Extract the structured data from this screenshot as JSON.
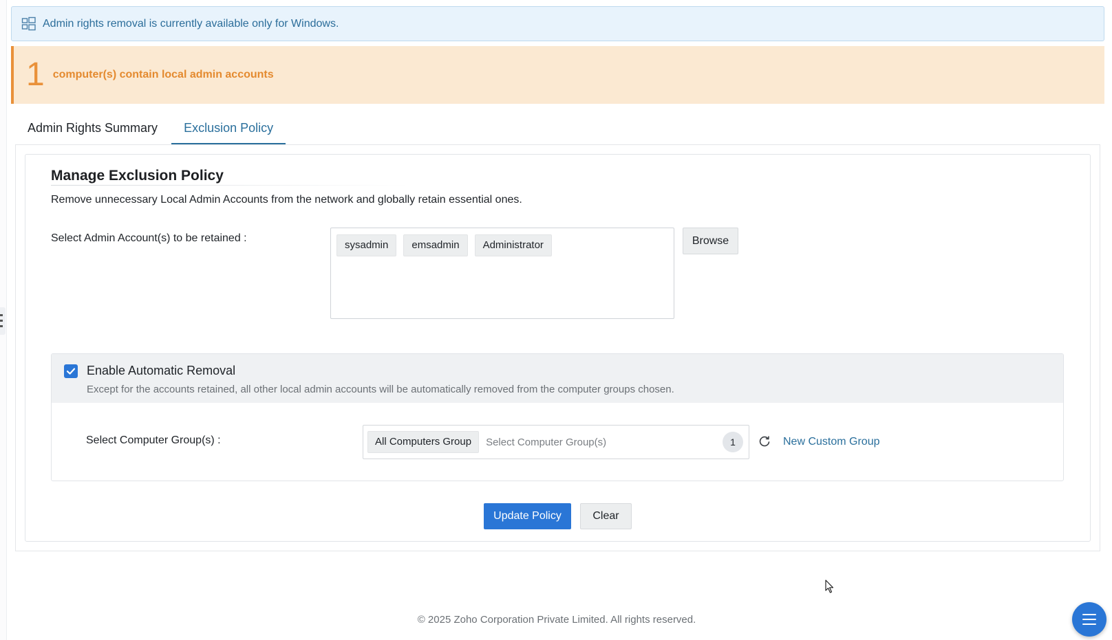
{
  "info_banner": {
    "text": "Admin rights removal is currently available only for Windows.",
    "icon": "windows-grid-icon"
  },
  "warning_banner": {
    "count": "1",
    "text": "computer(s) contain local admin accounts"
  },
  "tabs": [
    {
      "label": "Admin Rights Summary",
      "active": false
    },
    {
      "label": "Exclusion Policy",
      "active": true
    }
  ],
  "policy": {
    "title": "Manage Exclusion Policy",
    "description": "Remove unnecessary Local Admin Accounts from the network and globally retain essential ones.",
    "accounts_label": "Select Admin Account(s) to be retained :",
    "accounts": [
      "sysadmin",
      "emsadmin",
      "Administrator"
    ],
    "browse_label": "Browse"
  },
  "auto_removal": {
    "checked": true,
    "title": "Enable Automatic Removal",
    "description": "Except for the accounts retained, all other local admin accounts will be automatically removed from the computer groups chosen.",
    "groups_label": "Select Computer Group(s) :",
    "selected_group": "All Computers Group",
    "placeholder": "Select Computer Group(s)",
    "selected_count": "1",
    "new_group_label": "New Custom Group"
  },
  "actions": {
    "update_label": "Update Policy",
    "clear_label": "Clear"
  },
  "footer": {
    "text": "© 2025 Zoho Corporation Private Limited. All rights reserved."
  },
  "colors": {
    "accent": "#2a76d6",
    "warning": "#e9913a",
    "info_bg": "#e8f3fc",
    "link": "#2a6f9c"
  }
}
